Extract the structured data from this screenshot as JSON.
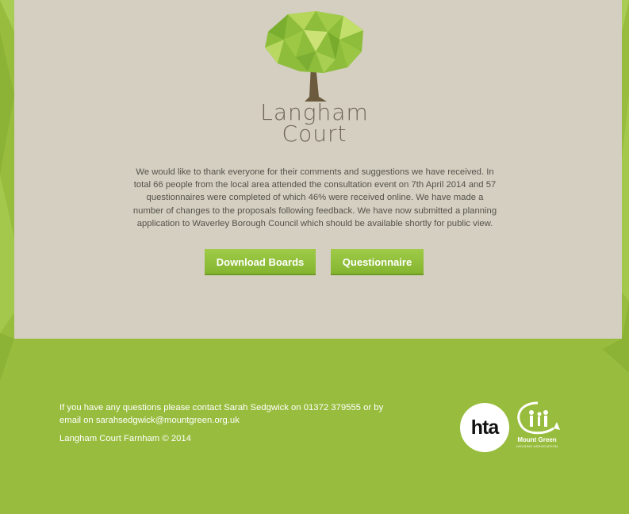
{
  "colors": {
    "background_green": "#98bd3e",
    "panel_beige": "#d4cfc1",
    "button_green": "#8fbf3a",
    "brand_text": "#6e6655"
  },
  "logo": {
    "icon": "tree-icon",
    "line1": "Langham",
    "line2": "Court"
  },
  "intro": {
    "text": "We would like to thank everyone for their comments and suggestions we have received. In total 66 people from the local area attended the consultation event on 7th April 2014 and 57 questionnaires were completed of which 46% were received online. We have made a number of changes to the proposals following feedback. We have now submitted a planning application to Waverley Borough Council which should be available shortly for public view."
  },
  "buttons": {
    "download": "Download Boards",
    "questionnaire": "Questionnaire"
  },
  "footer": {
    "contact_prefix": "If you have any questions please contact Sarah Sedgwick on 01372 379555 or by email on ",
    "email": "sarahsedgwick@mountgreen.org.uk",
    "copyright": "Langham Court Farnham © 2014"
  },
  "partners": {
    "hta": "hta",
    "mount_green": "Mount Green",
    "mount_green_sub": "HOUSING ASSOCIATION"
  }
}
